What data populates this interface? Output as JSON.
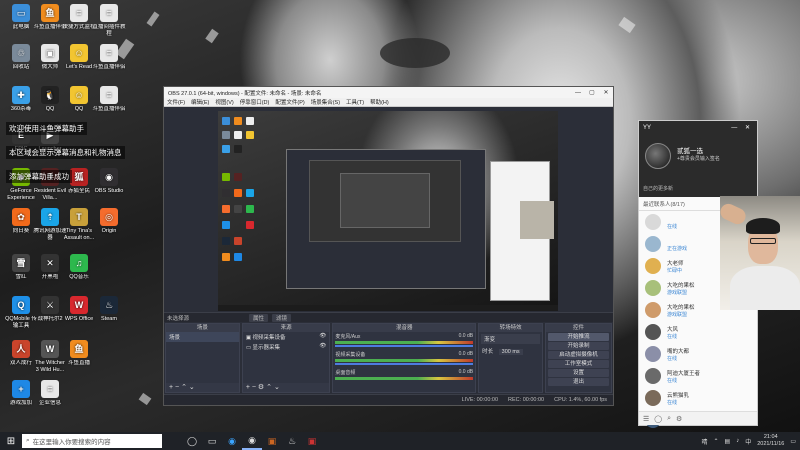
{
  "desktop_icons": [
    {
      "label": "此电脑",
      "color": "#3b8ed8",
      "glyph": "▭",
      "icon": "computer-icon"
    },
    {
      "label": "斗鱼直播伴侣",
      "color": "#f08c1e",
      "glyph": "鱼",
      "icon": "douyu-icon"
    },
    {
      "label": "快捷方式监视",
      "color": "#e8e8e8",
      "glyph": "≡",
      "icon": "doc-icon"
    },
    {
      "label": "直播间插件教程",
      "color": "#e8e8e8",
      "glyph": "≡",
      "icon": "doc-icon"
    },
    {
      "label": "回收站",
      "color": "#7a8a9a",
      "glyph": "♲",
      "icon": "recycle-bin-icon"
    },
    {
      "label": "微大师",
      "color": "#e8e8e8",
      "glyph": "▣",
      "icon": "app-icon"
    },
    {
      "label": "Let's Read",
      "color": "#f2c531",
      "glyph": "☺",
      "icon": "app-icon"
    },
    {
      "label": "斗鱼直播伴侣",
      "color": "#e8e8e8",
      "glyph": "≡",
      "icon": "doc-icon"
    },
    {
      "label": "360杀毒",
      "color": "#3aa0e8",
      "glyph": "✚",
      "icon": "antivirus-icon"
    },
    {
      "label": "QQ",
      "color": "#222",
      "glyph": "🐧",
      "icon": "qq-icon"
    },
    {
      "label": "QQ",
      "color": "#f2c531",
      "glyph": "☺",
      "icon": "app-icon"
    },
    {
      "label": "斗鱼直播伴侣",
      "color": "#e8e8e8",
      "glyph": "≡",
      "icon": "doc-icon"
    },
    {
      "label": "EPIC",
      "color": "#333",
      "glyph": "E",
      "icon": "epic-icon"
    },
    {
      "label": "Launcher",
      "color": "#444",
      "glyph": "▶",
      "icon": "app-icon"
    },
    {
      "label": "GeForce Experience",
      "color": "#76b900",
      "glyph": "◆",
      "icon": "geforce-icon"
    },
    {
      "label": "Resident Evil Villa...",
      "color": "#552222",
      "glyph": "R",
      "icon": "game-icon"
    },
    {
      "label": "赤狐全民",
      "color": "#b82222",
      "glyph": "狐",
      "icon": "app-icon"
    },
    {
      "label": "OBS Studio",
      "color": "#302e31",
      "glyph": "◉",
      "icon": "obs-icon"
    },
    {
      "label": "向日葵",
      "color": "#f26a1b",
      "glyph": "✿",
      "icon": "app-icon"
    },
    {
      "label": "腾讯网游加速器",
      "color": "#1aa5e8",
      "glyph": "⇡",
      "icon": "app-icon"
    },
    {
      "label": "Tiny Tina's Assault on...",
      "color": "#c8a03a",
      "glyph": "T",
      "icon": "game-icon"
    },
    {
      "label": "Origin",
      "color": "#f56c2d",
      "glyph": "◎",
      "icon": "origin-icon"
    },
    {
      "label": "雪红",
      "color": "#444",
      "glyph": "雪",
      "icon": "app-icon"
    },
    {
      "label": "开黑啦",
      "color": "#333",
      "glyph": "✕",
      "icon": "app-icon"
    },
    {
      "label": "QQ音乐",
      "color": "#2db84d",
      "glyph": "♫",
      "icon": "app-icon"
    },
    {
      "label": "QQMobile 传输工具",
      "color": "#1e90e8",
      "glyph": "Q",
      "icon": "app-icon"
    },
    {
      "label": "战神托尔2",
      "color": "#333",
      "glyph": "⚔",
      "icon": "game-icon"
    },
    {
      "label": "WPS Office",
      "color": "#d8282e",
      "glyph": "W",
      "icon": "wps-icon"
    },
    {
      "label": "Steam",
      "color": "#1b2838",
      "glyph": "♨",
      "icon": "steam-icon"
    },
    {
      "label": "双人成行",
      "color": "#c9442b",
      "glyph": "人",
      "icon": "game-icon"
    },
    {
      "label": "The Witcher 3 Wild Hu...",
      "color": "#555",
      "glyph": "W",
      "icon": "game-icon"
    },
    {
      "label": "斗鱼直播",
      "color": "#f08c1e",
      "glyph": "鱼",
      "icon": "douyu-icon"
    },
    {
      "label": "游戏加加",
      "color": "#1e88e5",
      "glyph": "+",
      "icon": "app-icon"
    },
    {
      "label": "企业信息",
      "color": "#e8e8e8",
      "glyph": "≡",
      "icon": "doc-icon"
    }
  ],
  "danmaku": [
    "欢迎使用斗鱼弹幕助手",
    "本区域会显示弹幕消息和礼物消息",
    "添加弹幕助手成功"
  ],
  "obs": {
    "title": "OBS 27.0.1 (64-bit, windows) - 配置文件: 未命名 - 场景: 未命名",
    "menu": [
      "文件(F)",
      "编辑(E)",
      "视图(V)",
      "停靠窗口(D)",
      "配置文件(P)",
      "场景集合(S)",
      "工具(T)",
      "帮助(H)"
    ],
    "scene_label": "未选择源",
    "subbar_buttons": [
      "属性",
      "滤镜"
    ],
    "docks": {
      "scenes": {
        "title": "场景",
        "items": [
          "场景"
        ]
      },
      "sources": {
        "title": "来源",
        "items": [
          "视频采集设备",
          "显示器采集"
        ]
      },
      "mixer": {
        "title": "混音器",
        "channels": [
          {
            "name": "麦克风/Aux",
            "db": "0.0 dB"
          },
          {
            "name": "视频采集设备",
            "db": "0.0 dB"
          },
          {
            "name": "桌面音频",
            "db": "0.0 dB"
          }
        ]
      },
      "transitions": {
        "title": "转场特效",
        "type": "渐变",
        "duration_label": "时长",
        "duration": "300 ms"
      },
      "controls": {
        "title": "控件",
        "buttons": [
          "开始推流",
          "开始录制",
          "启动虚拟摄像机",
          "工作室模式",
          "设置",
          "退出"
        ]
      }
    },
    "status": {
      "live": "LIVE: 00:00:00",
      "rec": "REC: 00:00:00",
      "cpu": "CPU: 1.4%, 60.00 fps"
    }
  },
  "chat": {
    "app": "YY",
    "username": "贰狐一选",
    "signature": "+尊贵会员输入签名",
    "subtitle": "自己的更多新",
    "tabs": "最近联系人(8/17)",
    "items": [
      {
        "name": "",
        "status": "在线",
        "color": "#d9d9d9"
      },
      {
        "name": "",
        "status": "正在游戏",
        "color": "#9ab7cf"
      },
      {
        "name": "大老师",
        "status": "忙碌中",
        "color": "#e0b050"
      },
      {
        "name": "大吃的果松",
        "status": "游戏联盟",
        "color": "#a8c07a"
      },
      {
        "name": "大吃的果松",
        "status": "游戏联盟",
        "color": "#cf9b6a"
      },
      {
        "name": "大风",
        "status": "在线",
        "color": "#555"
      },
      {
        "name": "嘴的大都",
        "status": "在线",
        "color": "#8b8fa8"
      },
      {
        "name": "阿迪大厦王者",
        "status": "在线",
        "color": "#6a6a6a"
      },
      {
        "name": "云熊猫乳",
        "status": "在线",
        "color": "#7a6a5a"
      },
      {
        "name": "",
        "status": "",
        "color": "#3d5a7a"
      }
    ]
  },
  "taskbar": {
    "search_placeholder": "在这里输入你要搜索的内容",
    "time": "21:04",
    "date": "2021/11/16",
    "ime": "中",
    "weather": "晴"
  }
}
